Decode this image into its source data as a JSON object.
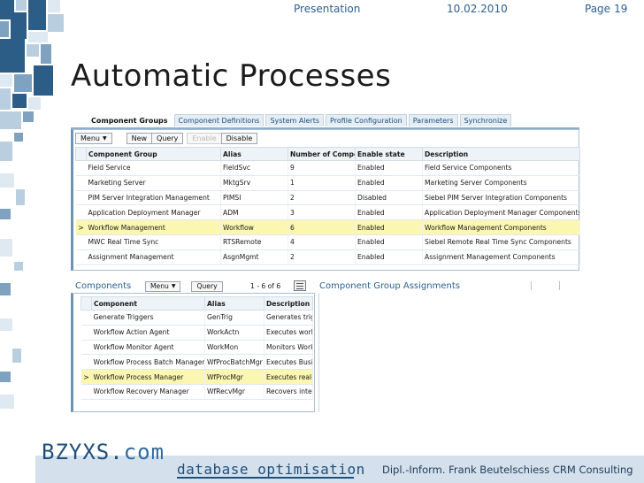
{
  "header": {
    "section": "Presentation",
    "date": "10.02.2010",
    "page_label": "Page",
    "page_number": "19"
  },
  "title": "Automatic Processes",
  "component_groups": {
    "tabs": [
      {
        "label": "Component Groups",
        "active": true
      },
      {
        "label": "Component Definitions",
        "active": false
      },
      {
        "label": "System Alerts",
        "active": false
      },
      {
        "label": "Profile Configuration",
        "active": false
      },
      {
        "label": "Parameters",
        "active": false
      },
      {
        "label": "Synchronize",
        "active": false
      }
    ],
    "toolbar": {
      "menu": "Menu",
      "new": "New",
      "query": "Query",
      "enable": "Enable",
      "disable": "Disable"
    },
    "columns": [
      "Component Group",
      "Alias",
      "Number of Compo",
      "Enable state",
      "Description"
    ],
    "rows": [
      {
        "group": "Field Service",
        "alias": "FieldSvc",
        "count": "9",
        "state": "Enabled",
        "description": "Field Service Components"
      },
      {
        "group": "Marketing Server",
        "alias": "MktgSrv",
        "count": "1",
        "state": "Enabled",
        "description": "Marketing Server Components"
      },
      {
        "group": "PIM Server Integration Management",
        "alias": "PIMSI",
        "count": "2",
        "state": "Disabled",
        "description": "Siebel PIM Server Integration Components"
      },
      {
        "group": "Application Deployment Manager",
        "alias": "ADM",
        "count": "3",
        "state": "Enabled",
        "description": "Application Deployment Manager Components"
      },
      {
        "group": "Workflow Management",
        "alias": "Workflow",
        "count": "6",
        "state": "Enabled",
        "description": "Workflow Management Components"
      },
      {
        "group": "MWC Real Time Sync",
        "alias": "RTSRemote",
        "count": "4",
        "state": "Enabled",
        "description": "Siebel Remote Real Time Sync Components"
      },
      {
        "group": "Assignment Management",
        "alias": "AsgnMgmt",
        "count": "2",
        "state": "Enabled",
        "description": "Assignment Management Components"
      }
    ],
    "selected_marker": ">",
    "selected_row": 4
  },
  "components": {
    "title": "Components",
    "menu": "Menu",
    "query": "Query",
    "record_count": "1 - 6 of 6",
    "columns": [
      "Component",
      "Alias",
      "Description"
    ],
    "rows": [
      {
        "name": "Generate Triggers",
        "alias": "GenTrig",
        "description": "Generates trigge"
      },
      {
        "name": "Workflow Action Agent",
        "alias": "WorkActn",
        "description": "Executes workfl"
      },
      {
        "name": "Workflow Monitor Agent",
        "alias": "WorkMon",
        "description": "Monitors Workfl"
      },
      {
        "name": "Workflow Process Batch Manager",
        "alias": "WfProcBatchMgr",
        "description": "Executes Busine"
      },
      {
        "name": "Workflow Process Manager",
        "alias": "WfProcMgr",
        "description": "Executes real-tir"
      },
      {
        "name": "Workflow Recovery Manager",
        "alias": "WfRecvMgr",
        "description": "Recovers interru"
      }
    ],
    "selected_marker": ">",
    "selected_row": 4
  },
  "assignments": {
    "title": "Component Group Assignments"
  },
  "footer": {
    "logo_main": "BZYXS.",
    "logo_tld": "com",
    "tagline": "database optimisation",
    "credit": "Dipl.-Inform. Frank Beutelschiess CRM Consulting"
  },
  "colors": {
    "brand_blue": "#2c5d86",
    "highlight_row": "#fbf7b0",
    "header_text": "#2b5f8e"
  }
}
